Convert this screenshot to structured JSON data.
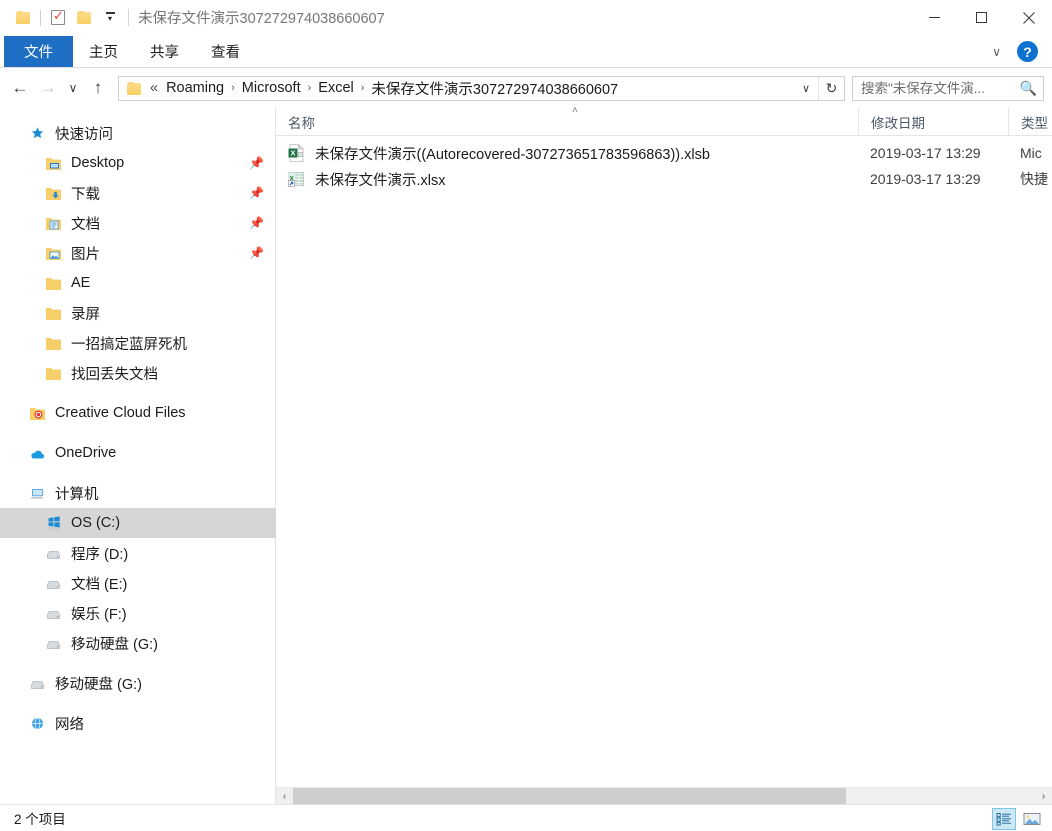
{
  "window": {
    "title": "未保存文件演示307272974038660607",
    "minimize_label": "最小化",
    "maximize_label": "最大化",
    "close_label": "关闭"
  },
  "quick_access_toolbar": {
    "items": [
      {
        "name": "folder-icon",
        "label": "属性"
      },
      {
        "name": "properties-icon",
        "label": "属性"
      },
      {
        "name": "new-folder-icon",
        "label": "新建文件夹"
      },
      {
        "name": "customize-caret",
        "label": "自定义快速访问工具栏"
      }
    ]
  },
  "ribbon": {
    "tabs": [
      {
        "label": "文件",
        "active": true
      },
      {
        "label": "主页",
        "active": false
      },
      {
        "label": "共享",
        "active": false
      },
      {
        "label": "查看",
        "active": false
      }
    ],
    "collapse_label": "∨",
    "help_label": "?"
  },
  "navigation": {
    "back_label": "←",
    "forward_label": "→",
    "recent_label": "∨",
    "up_label": "↑",
    "refresh_label": "↻",
    "address_caret": "∨"
  },
  "breadcrumb": {
    "ellipsis": "«",
    "separator": "›",
    "items": [
      "Roaming",
      "Microsoft",
      "Excel",
      "未保存文件演示307272974038660607"
    ]
  },
  "search": {
    "placeholder": "搜索\"未保存文件演...",
    "value": "",
    "icon": "search-icon"
  },
  "sidebar": {
    "sections": [
      {
        "header": {
          "label": "快速访问",
          "icon": "pin-star-icon"
        },
        "items": [
          {
            "label": "Desktop",
            "icon": "desktop-folder-icon",
            "pinned": true
          },
          {
            "label": "下载",
            "icon": "downloads-folder-icon",
            "pinned": true
          },
          {
            "label": "文档",
            "icon": "documents-folder-icon",
            "pinned": true
          },
          {
            "label": "图片",
            "icon": "pictures-folder-icon",
            "pinned": true
          },
          {
            "label": "AE",
            "icon": "folder-icon",
            "pinned": false
          },
          {
            "label": "录屏",
            "icon": "folder-icon",
            "pinned": false
          },
          {
            "label": "一招搞定蓝屏死机",
            "icon": "folder-icon",
            "pinned": false
          },
          {
            "label": "找回丢失文档",
            "icon": "folder-icon",
            "pinned": false
          }
        ]
      },
      {
        "header": {
          "label": "Creative Cloud Files",
          "icon": "creative-cloud-icon"
        },
        "items": []
      },
      {
        "header": {
          "label": "OneDrive",
          "icon": "onedrive-cloud-icon"
        },
        "items": []
      },
      {
        "header": {
          "label": "计算机",
          "icon": "computer-icon"
        },
        "items": [
          {
            "label": "OS (C:)",
            "icon": "windows-drive-icon",
            "selected": true
          },
          {
            "label": "程序 (D:)",
            "icon": "drive-icon",
            "selected": false
          },
          {
            "label": "文档 (E:)",
            "icon": "drive-icon",
            "selected": false
          },
          {
            "label": "娱乐 (F:)",
            "icon": "drive-icon",
            "selected": false
          },
          {
            "label": "移动硬盘 (G:)",
            "icon": "drive-icon",
            "selected": false
          }
        ]
      },
      {
        "header": {
          "label": "移动硬盘 (G:)",
          "icon": "drive-icon"
        },
        "items": []
      },
      {
        "header": {
          "label": "网络",
          "icon": "network-icon"
        },
        "items": []
      }
    ]
  },
  "file_list": {
    "columns": [
      {
        "label": "名称",
        "sorted": true,
        "sort_direction": "asc"
      },
      {
        "label": "修改日期",
        "sorted": false
      },
      {
        "label": "类型",
        "sorted": false
      }
    ],
    "rows": [
      {
        "name": "未保存文件演示((Autorecovered-307273651783596863)).xlsb",
        "date": "2019-03-17 13:29",
        "type": "Mic",
        "icon": "excel-xlsb-file-icon"
      },
      {
        "name": "未保存文件演示.xlsx",
        "date": "2019-03-17 13:29",
        "type": "快捷",
        "icon": "excel-shortcut-file-icon"
      }
    ]
  },
  "scrollbar": {
    "left_label": "‹",
    "right_label": "›"
  },
  "statusbar": {
    "item_count": "2 个项目",
    "view_details_label": "详细信息",
    "view_large_icons_label": "大图标"
  },
  "colors": {
    "accent": "#1e6fc4",
    "selection": "#d6d6d6",
    "hover": "#e5f3fb",
    "view_active": "#cce8f4",
    "excel_green": "#217346"
  }
}
